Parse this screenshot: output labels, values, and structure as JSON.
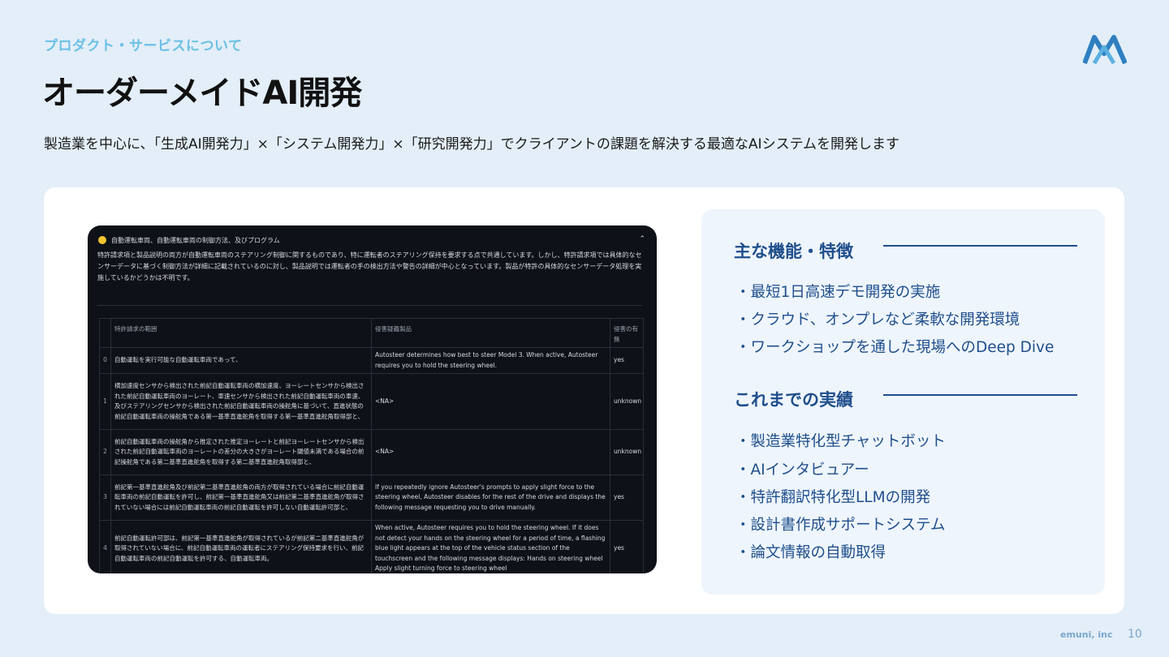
{
  "header": {
    "section_label": "プロダクト・サービスについて",
    "title": "オーダーメイドAI開発",
    "subtitle": "製造業を中心に、「生成AI開発力」×「システム開発力」×「研究開発力」でクライアントの課題を解決する最適なAIシステムを開発します"
  },
  "screenshot": {
    "header_title": "自動運転車両、自動運転車両の制御方法、及びプログラム",
    "chevron": "⌃",
    "body_text": "特許請求項と製品説明の両方が自動運転車両のステアリング制御に関するものであり、特に運転者のステアリング保持を要求する点で共通しています。しかし、特許請求項では具体的なセンサーデータに基づく制御方法が詳細に記載されているのに対し、製品説明では運転者の手の検出方法や警告の詳細が中心となっています。製品が特許の具体的なセンサーデータ処理を実施しているかどうかは不明です。",
    "table": {
      "headers": [
        "",
        "特許請求の範囲",
        "侵害疑義製品",
        "侵害の有無"
      ],
      "rows": [
        {
          "idx": "0",
          "claim": "自動運転を実行可能な自動運転車両であって、",
          "product": "Autosteer determines how best to steer Model 3. When active, Autosteer requires you to hold the steering wheel.",
          "result": "yes"
        },
        {
          "idx": "1",
          "claim": "横加速度センサから検出された前記自動運転車両の横加速度、ヨーレートセンサから検出された前記自動運転車両のヨーレート、車速センサから検出された前記自動運転車両の車速、及びステアリングセンサから検出された前記自動運転車両の操舵角に基づいて、直進状態の前記自動運転車両の操舵角である第一基準直進舵角を取得する第一基準直進舵角取得部と、",
          "product": "<NA>",
          "result": "unknown"
        },
        {
          "idx": "2",
          "claim": "前記自動運転車両の操舵角から推定された推定ヨーレートと前記ヨーレートセンサから検出された前記自動運転車両のヨーレートの差分の大きさがヨーレート閾値未満である場合の前記操舵角である第二基準直進舵角を取得する第二基準直進舵角取得部と、",
          "product": "<NA>",
          "result": "unknown"
        },
        {
          "idx": "3",
          "claim": "前記第一基準直進舵角及び前記第二基準直進舵角の両方が取得されている場合に前記自動運転車両の前記自動運転を許可し、前記第一基準直進舵角又は前記第二基準直進舵角が取得されていない場合には前記自動運転車両の前記自動運転を許可しない自動運転許可部と、",
          "product": "If you repeatedly ignore Autosteer's prompts to apply slight force to the steering wheel, Autosteer disables for the rest of the drive and displays the following message requesting you to drive manually.",
          "result": "yes"
        },
        {
          "idx": "4",
          "claim": "前記自動運転許可部は、前記第一基準直進舵角が取得されているが前記第二基準直進舵角が取得されていない場合に、前記自動運転車両の運転者にステアリング保持要求を行い、前記自動運転車両の前記自動運転を許可する、自動運転車両。",
          "product": "When active, Autosteer requires you to hold the steering wheel. If it does not detect your hands on the steering wheel for a period of time, a flashing blue light appears at the top of the vehicle status section of the touchscreen and the following message displays: Hands on steering wheel Apply slight turning force to steering wheel",
          "result": "yes"
        }
      ]
    }
  },
  "features": {
    "heading": "主な機能・特徴",
    "items": [
      "・最短1日高速デモ開発の実施",
      "・クラウド、オンプレなど柔軟な開発環境",
      "・ワークショップを通した現場へのDeep Dive"
    ]
  },
  "achievements": {
    "heading": "これまでの実績",
    "items": [
      "・製造業特化型チャットボット",
      "・AIインタビュアー",
      "・特許翻訳特化型LLMの開発",
      "・設計書作成サポートシステム",
      "・論文情報の自動取得"
    ]
  },
  "footer": {
    "company": "emuni, inc",
    "page": "10"
  },
  "colors": {
    "background": "#e3eef8",
    "accent": "#1f4e8c",
    "section_label": "#6cc0e6",
    "logo": "#2f7fc1"
  }
}
